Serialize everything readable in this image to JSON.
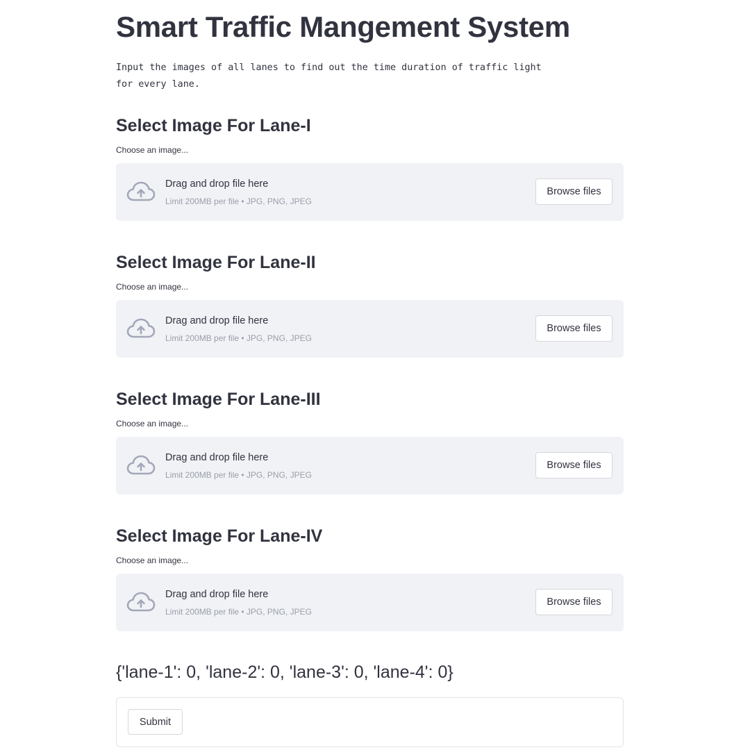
{
  "app": {
    "title": "Smart Traffic Mangement System",
    "description": "Input the images of all lanes to find out the time duration of traffic light\nfor every lane."
  },
  "lanes": [
    {
      "heading": "Select Image For Lane-I",
      "label": "Choose an image...",
      "dropzone_text": "Drag and drop file here",
      "limit_text": "Limit 200MB per file • JPG, PNG, JPEG",
      "button_label": "Browse files"
    },
    {
      "heading": "Select Image For Lane-II",
      "label": "Choose an image...",
      "dropzone_text": "Drag and drop file here",
      "limit_text": "Limit 200MB per file • JPG, PNG, JPEG",
      "button_label": "Browse files"
    },
    {
      "heading": "Select Image For Lane-III",
      "label": "Choose an image...",
      "dropzone_text": "Drag and drop file here",
      "limit_text": "Limit 200MB per file • JPG, PNG, JPEG",
      "button_label": "Browse files"
    },
    {
      "heading": "Select Image For Lane-IV",
      "label": "Choose an image...",
      "dropzone_text": "Drag and drop file here",
      "limit_text": "Limit 200MB per file • JPG, PNG, JPEG",
      "button_label": "Browse files"
    }
  ],
  "result": {
    "text": "{'lane-1': 0, 'lane-2': 0, 'lane-3': 0, 'lane-4': 0}"
  },
  "form": {
    "submit_label": "Submit"
  },
  "icons": {
    "upload": "cloud-upload-icon"
  },
  "colors": {
    "text": "#31333f",
    "dropzone_bg": "#f0f2f6",
    "muted_text": "#9a9ea8",
    "icon": "#a3a8b8"
  }
}
